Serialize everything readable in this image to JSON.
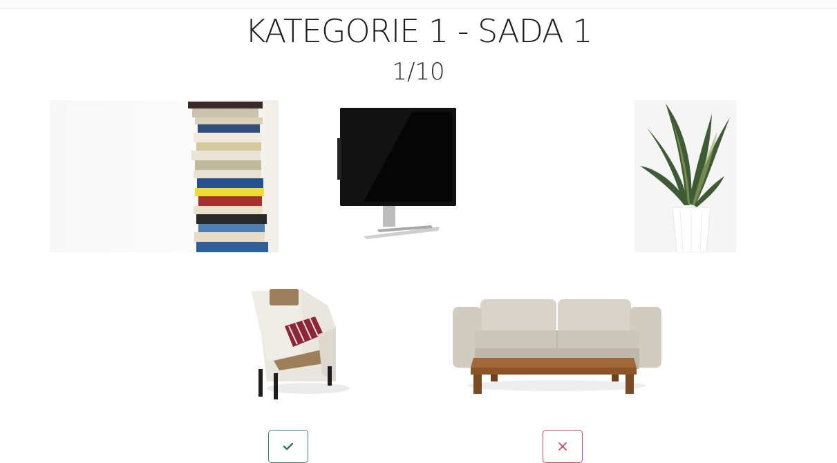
{
  "header": {
    "title": "KATEGORIE 1 - SADA 1",
    "counter": "1/10"
  },
  "images": [
    {
      "name": "books",
      "icon": "book-stack-image"
    },
    {
      "name": "monitor",
      "icon": "monitor-image"
    },
    {
      "name": "plant",
      "icon": "potted-plant-image"
    },
    {
      "name": "armchair",
      "icon": "armchair-image"
    },
    {
      "name": "sofa",
      "icon": "sofa-with-table-image"
    }
  ],
  "actions": {
    "confirm_icon": "check-icon",
    "reject_icon": "close-icon",
    "confirm_color": "#3c8a64",
    "reject_color": "#d4465a"
  }
}
